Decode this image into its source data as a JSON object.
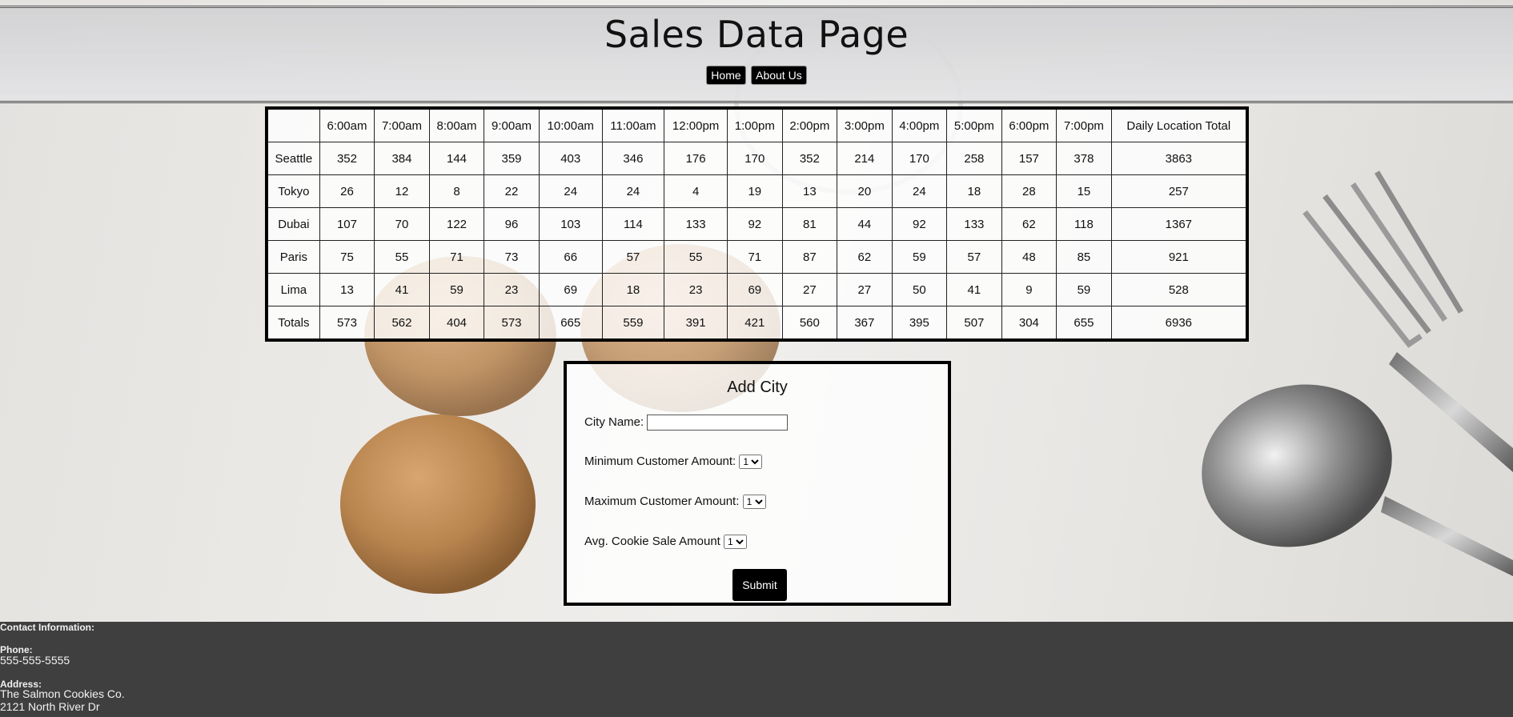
{
  "header": {
    "title": "Sales Data Page"
  },
  "nav": {
    "home": "Home",
    "about": "About Us"
  },
  "table": {
    "corner": "",
    "headers": [
      "6:00am",
      "7:00am",
      "8:00am",
      "9:00am",
      "10:00am",
      "11:00am",
      "12:00pm",
      "1:00pm",
      "2:00pm",
      "3:00pm",
      "4:00pm",
      "5:00pm",
      "6:00pm",
      "7:00pm",
      "Daily Location Total"
    ],
    "rows": [
      {
        "city": "Seattle",
        "values": [
          352,
          384,
          144,
          359,
          403,
          346,
          176,
          170,
          352,
          214,
          170,
          258,
          157,
          378,
          3863
        ]
      },
      {
        "city": "Tokyo",
        "values": [
          26,
          12,
          8,
          22,
          24,
          24,
          4,
          19,
          13,
          20,
          24,
          18,
          28,
          15,
          257
        ]
      },
      {
        "city": "Dubai",
        "values": [
          107,
          70,
          122,
          96,
          103,
          114,
          133,
          92,
          81,
          44,
          92,
          133,
          62,
          118,
          1367
        ]
      },
      {
        "city": "Paris",
        "values": [
          75,
          55,
          71,
          73,
          66,
          57,
          55,
          71,
          87,
          62,
          59,
          57,
          48,
          85,
          921
        ]
      },
      {
        "city": "Lima",
        "values": [
          13,
          41,
          59,
          23,
          69,
          18,
          23,
          69,
          27,
          27,
          50,
          41,
          9,
          59,
          528
        ]
      },
      {
        "city": "Totals",
        "values": [
          573,
          562,
          404,
          573,
          665,
          559,
          391,
          421,
          560,
          367,
          395,
          507,
          304,
          655,
          6936
        ]
      }
    ]
  },
  "form": {
    "title": "Add City",
    "city_label": "City Name:",
    "city_value": "",
    "min_label": "Minimum Customer Amount:",
    "min_value": "1",
    "max_label": "Maximum Customer Amount:",
    "max_value": "1",
    "avg_label": "Avg. Cookie Sale Amount",
    "avg_value": "1",
    "submit": "Submit"
  },
  "footer": {
    "contact_heading": "Contact Information:",
    "phone_label": "Phone:",
    "phone": "555-555-5555",
    "address_label": "Address:",
    "address_line1": "The Salmon Cookies Co.",
    "address_line2": "2121 North River Dr"
  }
}
